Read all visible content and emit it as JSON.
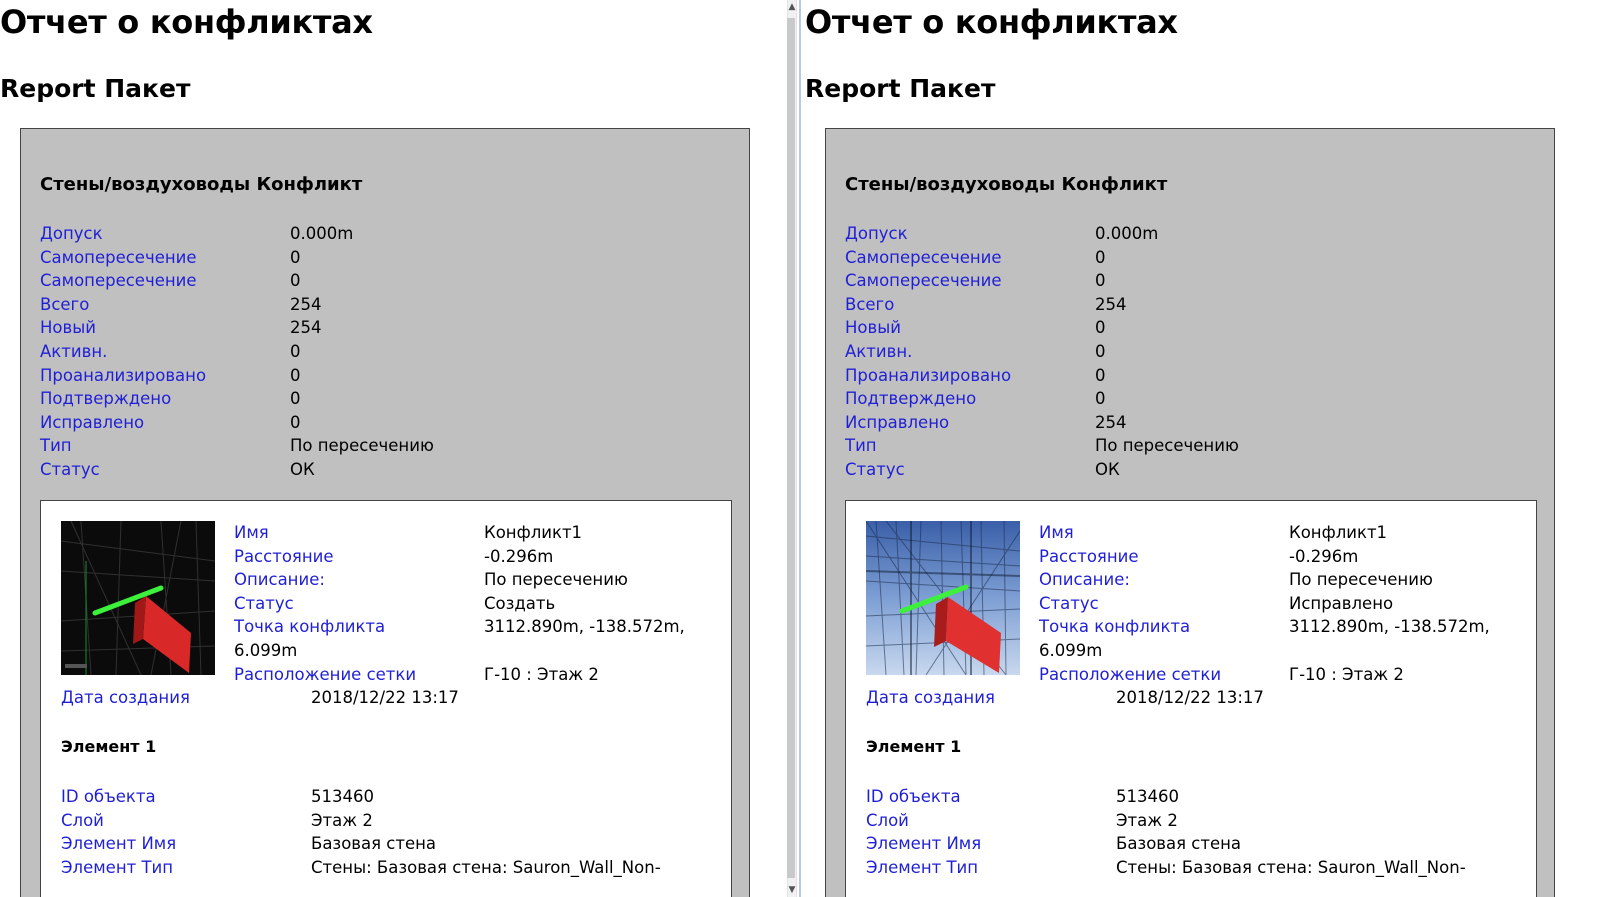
{
  "panes": [
    {
      "title": "Отчет о конфликтах",
      "subtitle": "Report Пакет",
      "test": {
        "name": "Стены/воздуховоды Конфликт",
        "rows": [
          {
            "label": "Допуск",
            "value": "0.000m"
          },
          {
            "label": "Самопересечение",
            "value": "0"
          },
          {
            "label": "Самопересечение",
            "value": "0"
          },
          {
            "label": "Всего",
            "value": "254"
          },
          {
            "label": "Новый",
            "value": "254"
          },
          {
            "label": "Активн.",
            "value": "0"
          },
          {
            "label": "Проанализировано",
            "value": "0"
          },
          {
            "label": "Подтверждено",
            "value": "0"
          },
          {
            "label": "Исправлено",
            "value": "0"
          },
          {
            "label": "Тип",
            "value": "По пересечению"
          },
          {
            "label": "Статус",
            "value": "ОК"
          }
        ]
      },
      "clash": {
        "thumbnail_style": "dark",
        "rows": [
          {
            "label": "Имя",
            "value": "Конфликт1"
          },
          {
            "label": "Расстояние",
            "value": "-0.296m"
          },
          {
            "label": "Описание:",
            "value": "По пересечению"
          },
          {
            "label": "Статус",
            "value": "Создать"
          },
          {
            "label": "Точка конфликта",
            "value": "3112.890m,  -138.572m,"
          }
        ],
        "point_cont": "6.099m",
        "grid": {
          "label": "Расположение сетки",
          "value": "Г-10 : Этаж 2"
        },
        "created": {
          "label": "Дата создания",
          "value": "2018/12/22  13:17"
        },
        "element_title": "Элемент 1",
        "element_rows": [
          {
            "label": "ID объекта",
            "value": "513460"
          },
          {
            "label": "Слой",
            "value": "Этаж 2"
          },
          {
            "label": "Элемент Имя",
            "value": "Базовая стена"
          },
          {
            "label": "Элемент Тип",
            "value": "Стены: Базовая стена: Sauron_Wall_Non-"
          }
        ]
      }
    },
    {
      "title": "Отчет о конфликтах",
      "subtitle": "Report Пакет",
      "test": {
        "name": "Стены/воздуховоды Конфликт",
        "rows": [
          {
            "label": "Допуск",
            "value": "0.000m"
          },
          {
            "label": "Самопересечение",
            "value": "0"
          },
          {
            "label": "Самопересечение",
            "value": "0"
          },
          {
            "label": "Всего",
            "value": "254"
          },
          {
            "label": "Новый",
            "value": "0"
          },
          {
            "label": "Активн.",
            "value": "0"
          },
          {
            "label": "Проанализировано",
            "value": "0"
          },
          {
            "label": "Подтверждено",
            "value": "0"
          },
          {
            "label": "Исправлено",
            "value": "254"
          },
          {
            "label": "Тип",
            "value": "По пересечению"
          },
          {
            "label": "Статус",
            "value": "ОК"
          }
        ]
      },
      "clash": {
        "thumbnail_style": "blue",
        "rows": [
          {
            "label": "Имя",
            "value": "Конфликт1"
          },
          {
            "label": "Расстояние",
            "value": "-0.296m"
          },
          {
            "label": "Описание:",
            "value": "По пересечению"
          },
          {
            "label": "Статус",
            "value": "Исправлено"
          },
          {
            "label": "Точка конфликта",
            "value": "3112.890m,  -138.572m,"
          }
        ],
        "point_cont": "6.099m",
        "grid": {
          "label": "Расположение сетки",
          "value": "Г-10 : Этаж 2"
        },
        "created": {
          "label": "Дата создания",
          "value": "2018/12/22  13:17"
        },
        "element_title": "Элемент 1",
        "element_rows": [
          {
            "label": "ID объекта",
            "value": "513460"
          },
          {
            "label": "Слой",
            "value": "Этаж 2"
          },
          {
            "label": "Элемент Имя",
            "value": "Базовая стена"
          },
          {
            "label": "Элемент Тип",
            "value": "Стены: Базовая стена: Sauron_Wall_Non-"
          }
        ]
      }
    }
  ],
  "colors": {
    "label": "#1f1fd6",
    "panel_gray": "#c0c0c0",
    "clash_red": "#e03030",
    "clash_green": "#35e035"
  }
}
